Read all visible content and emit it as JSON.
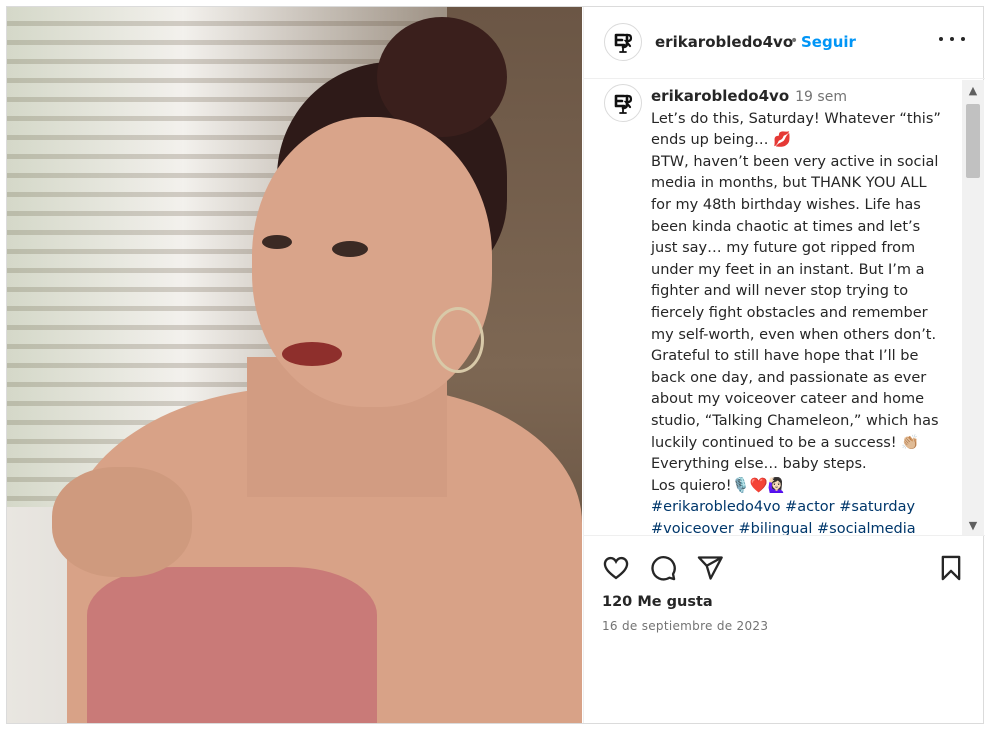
{
  "post": {
    "username": "erikarobledo4vo",
    "separator": "•",
    "follow_label": "Seguir",
    "more_icon": "more-horizontal-icon",
    "time_ago": "19 sem",
    "caption_lines": [
      "Let’s do this, Saturday! Whatever “this” ends up being… 💋",
      "BTW, haven’t been very active in social media in months, but THANK YOU ALL for my 48th birthday wishes. Life has been kinda chaotic at times and let’s just say… my future got ripped from under my feet in an instant. But I’m a fighter and will never stop trying to fiercely fight obstacles and remember my self-worth, even when others don’t. Grateful to still have hope that I’ll be back one day, and passionate as ever about my voiceover cateer and home studio, “Talking Chameleon,” which has luckily continued to be a success! 👏🏼",
      "Everything else… baby steps.",
      "Los quiero!🎙️❤️🙋🏻‍♀️"
    ],
    "hashtags": "#erikarobledo4vo #actor #saturday #voiceover #bilingual #socialmedia",
    "likes": "120 Me gusta",
    "date": "16 de septiembre de 2023"
  },
  "icons": {
    "like": "heart-icon",
    "comment": "comment-icon",
    "share": "share-icon",
    "save": "bookmark-icon"
  },
  "colors": {
    "accent": "#0095f6",
    "hashtag": "#00376b",
    "text": "#262626",
    "muted": "#737373"
  }
}
